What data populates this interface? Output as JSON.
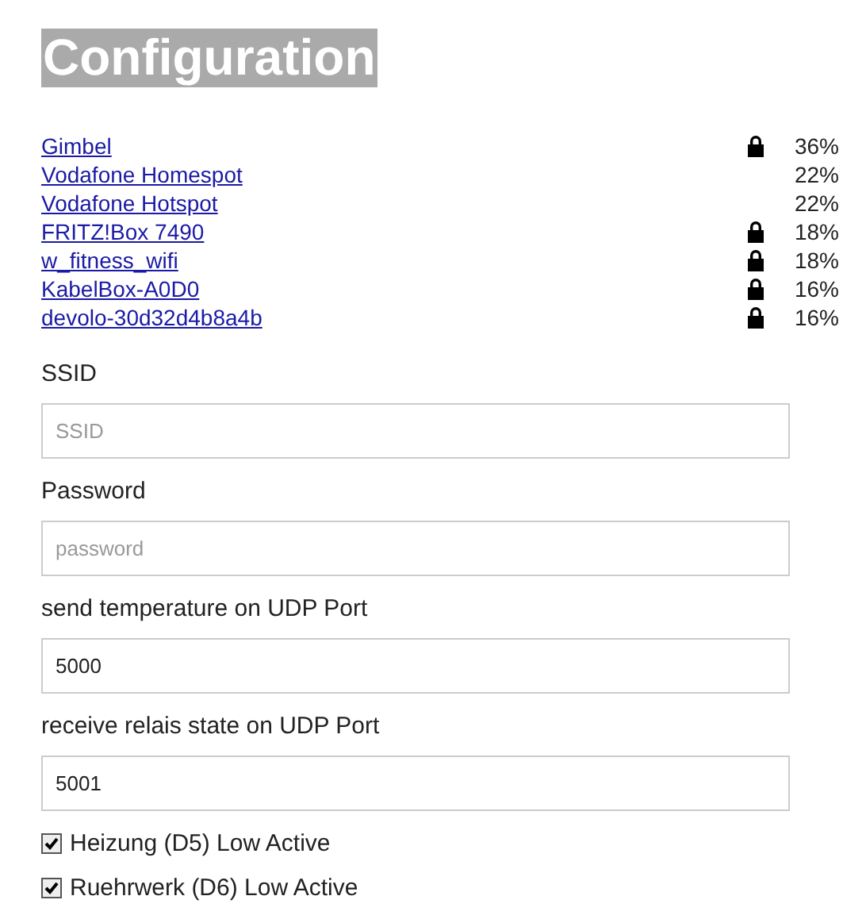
{
  "title": "Configuration",
  "networks": [
    {
      "name": "Gimbel",
      "locked": true,
      "signal": "36%"
    },
    {
      "name": "Vodafone Homespot",
      "locked": false,
      "signal": "22%"
    },
    {
      "name": "Vodafone Hotspot",
      "locked": false,
      "signal": "22%"
    },
    {
      "name": "FRITZ!Box 7490",
      "locked": true,
      "signal": "18%"
    },
    {
      "name": "w_fitness_wifi",
      "locked": true,
      "signal": "18%"
    },
    {
      "name": "KabelBox-A0D0",
      "locked": true,
      "signal": "16%"
    },
    {
      "name": "devolo-30d32d4b8a4b",
      "locked": true,
      "signal": "16%"
    }
  ],
  "fields": [
    {
      "label": "SSID",
      "placeholder": "SSID"
    },
    {
      "label": "Password",
      "placeholder": "password"
    },
    {
      "label": "send temperature on UDP Port",
      "value": "5000"
    },
    {
      "label": "receive relais state on UDP Port",
      "value": "5001"
    }
  ],
  "checkboxes": [
    {
      "label": "Heizung (D5) Low Active",
      "checked": true
    },
    {
      "label": "Ruehrwerk (D6) Low Active",
      "checked": true
    }
  ]
}
